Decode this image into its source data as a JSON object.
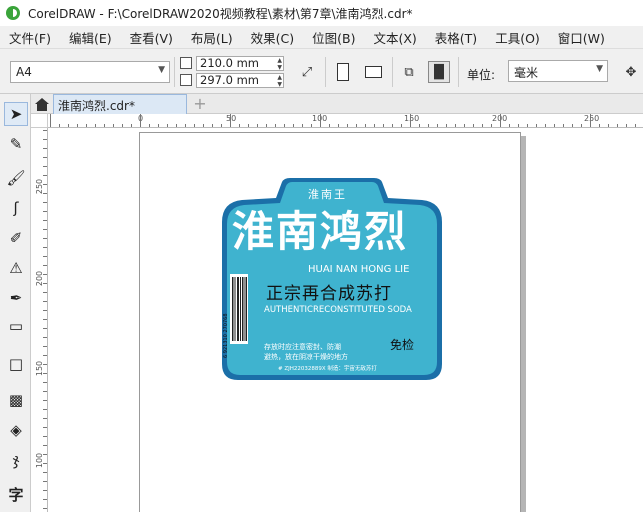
{
  "window": {
    "title": "CorelDRAW - F:\\CorelDRAW2020视频教程\\素材\\第7章\\淮南鸿烈.cdr*"
  },
  "menu": [
    {
      "name": "menu-file",
      "label": "文件(F)"
    },
    {
      "name": "menu-edit",
      "label": "编辑(E)"
    },
    {
      "name": "menu-view",
      "label": "查看(V)"
    },
    {
      "name": "menu-layout",
      "label": "布局(L)"
    },
    {
      "name": "menu-effects",
      "label": "效果(C)"
    },
    {
      "name": "menu-bitmap",
      "label": "位图(B)"
    },
    {
      "name": "menu-text",
      "label": "文本(X)"
    },
    {
      "name": "menu-table",
      "label": "表格(T)"
    },
    {
      "name": "menu-tools",
      "label": "工具(O)"
    },
    {
      "name": "menu-window",
      "label": "窗口(W)"
    }
  ],
  "propbar": {
    "page_size": "A4",
    "width": "210.0 mm",
    "height": "297.0 mm",
    "units_label": "单位:",
    "units_value": "毫米"
  },
  "tabs": {
    "document": "淮南鸿烈.cdr*"
  },
  "ruler": {
    "h_labels": [
      "0",
      "50",
      "100",
      "150",
      "200",
      "250"
    ],
    "v_labels": [
      "250",
      "200",
      "150",
      "100",
      "50"
    ]
  },
  "artwork": {
    "brand_small": "淮南王",
    "title": "淮南鸿烈",
    "pinyin": "HUAI NAN HONG LIE",
    "subtitle": "正宗再合成苏打",
    "english": "AUTHENTICRECONSTITUTED SODA",
    "storage_line1": "存放时应注意密封、防潮",
    "storage_line2": "避热，放在阴凉干燥的地方",
    "badge": "免检",
    "license": "# ZJH22032889X 制造：宇宙无敌苏打",
    "barcode_number": "6 921310 270768",
    "colors": {
      "label_fill": "#3fb3cf",
      "label_border": "#1b6fa8"
    }
  }
}
